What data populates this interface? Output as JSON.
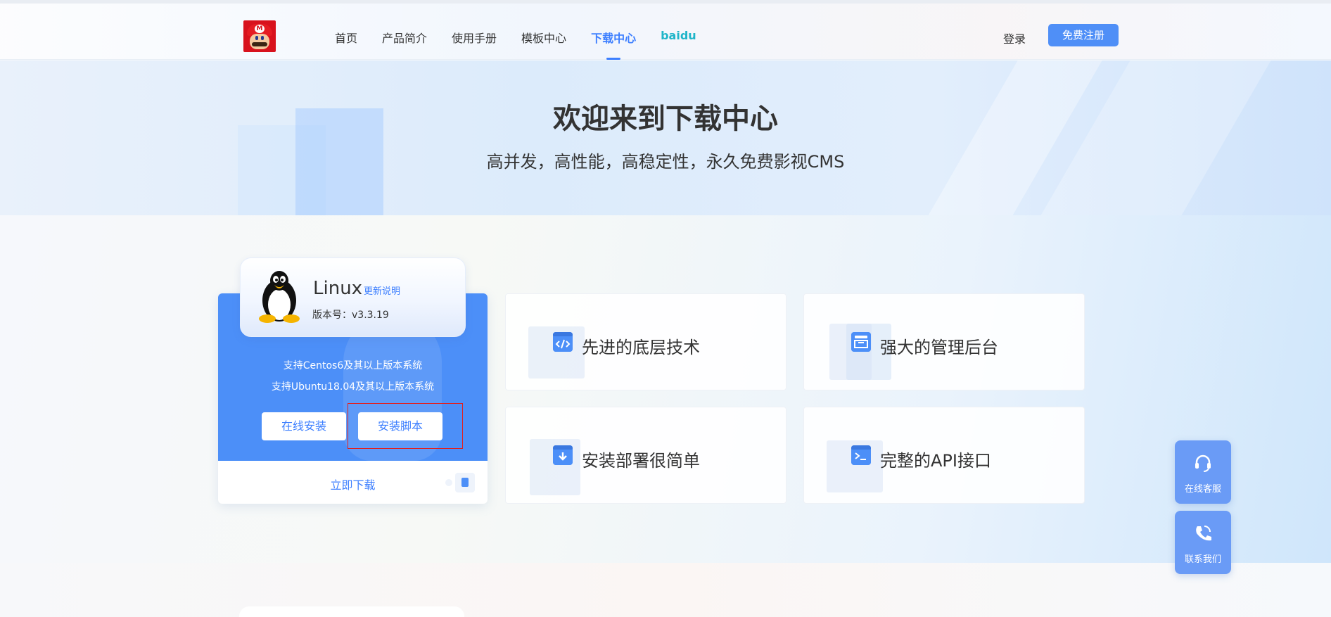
{
  "header": {
    "nav": [
      {
        "label": "首页"
      },
      {
        "label": "产品简介"
      },
      {
        "label": "使用手册"
      },
      {
        "label": "模板中心"
      },
      {
        "label": "下载中心",
        "active": true
      },
      {
        "label": "baidu"
      }
    ],
    "login_label": "登录",
    "register_label": "免费注册"
  },
  "hero": {
    "title": "欢迎来到下载中心",
    "subtitle": "高并发，高性能，高稳定性，永久免费影视CMS"
  },
  "download_card": {
    "os_name": "Linux",
    "release_notes_label": "更新说明",
    "version": "版本号：v3.3.19",
    "support_line1": "支持Centos6及其以上版本系统",
    "support_line2": "支持Ubuntu18.04及其以上版本系统",
    "online_install_label": "在线安装",
    "install_script_label": "安装脚本",
    "download_now_label": "立即下载"
  },
  "features": [
    {
      "label": "先进的底层技术",
      "icon": "code-icon"
    },
    {
      "label": "强大的管理后台",
      "icon": "inbox-icon"
    },
    {
      "label": "安装部署很简单",
      "icon": "download-box-icon"
    },
    {
      "label": "完整的API接口",
      "icon": "terminal-icon"
    }
  ],
  "floating": {
    "service_label": "在线客服",
    "contact_label": "联系我们"
  },
  "colors": {
    "accent": "#4c8ff8",
    "baidu": "#1fb5c9",
    "highlight_box": "#e02020"
  }
}
